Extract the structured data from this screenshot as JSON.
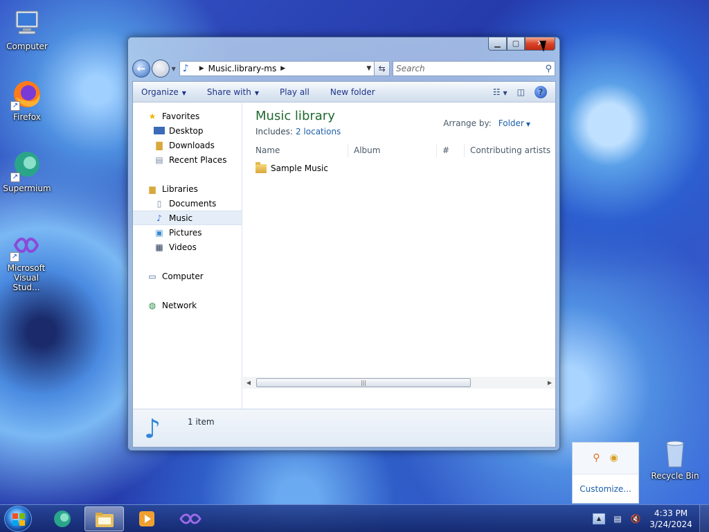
{
  "desktop": {
    "icons": [
      {
        "label": "Computer"
      },
      {
        "label": "Firefox"
      },
      {
        "label": "Supermium"
      },
      {
        "label": "Microsoft Visual Stud..."
      },
      {
        "label": "Recycle Bin"
      }
    ]
  },
  "window": {
    "address": {
      "path": "Music.library-ms",
      "search_placeholder": "Search"
    },
    "toolbar": {
      "organize": "Organize",
      "share_with": "Share with",
      "play_all": "Play all",
      "new_folder": "New folder",
      "help": "?"
    },
    "nav": {
      "favorites": "Favorites",
      "desktop": "Desktop",
      "downloads": "Downloads",
      "recent_places": "Recent Places",
      "libraries": "Libraries",
      "documents": "Documents",
      "music": "Music",
      "pictures": "Pictures",
      "videos": "Videos",
      "computer": "Computer",
      "network": "Network"
    },
    "library": {
      "title": "Music library",
      "includes_label": "Includes:",
      "includes_link": "2 locations",
      "arrange_label": "Arrange by:",
      "arrange_value": "Folder"
    },
    "columns": [
      "Name",
      "Album",
      "#",
      "Contributing artists"
    ],
    "items": [
      {
        "name": "Sample Music"
      }
    ],
    "status": {
      "count": "1 item"
    }
  },
  "tray_popup": {
    "customize": "Customize..."
  },
  "taskbar": {
    "clock_time": "4:33 PM",
    "clock_date": "3/24/2024"
  },
  "colors": {
    "library_title": "#1e6a2e",
    "link": "#1b5ea8",
    "toolbar_text": "#1e3287"
  }
}
